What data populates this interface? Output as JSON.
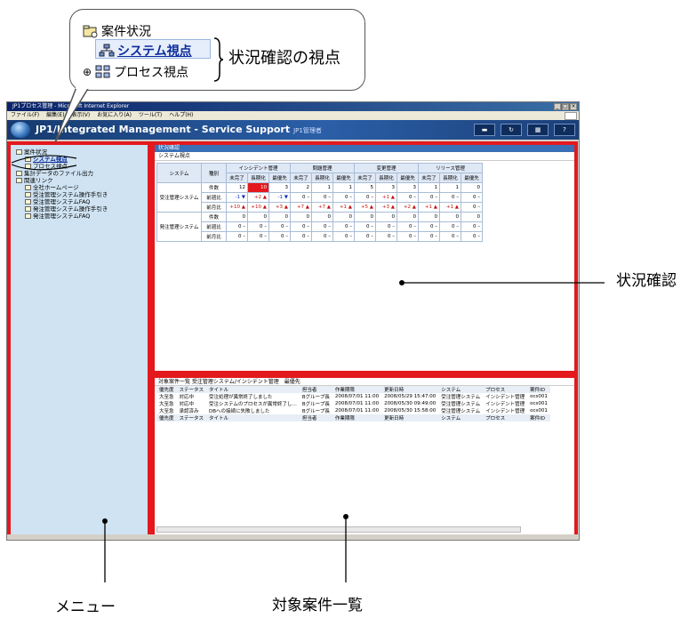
{
  "callout": {
    "line1": "案件状況",
    "line2": "システム視点",
    "line3": "プロセス視点",
    "label": "状況確認の視点"
  },
  "window": {
    "title": "JP1プロセス管理 - Microsoft Internet Explorer",
    "menu": [
      "ファイル(F)",
      "編集(E)",
      "表示(V)",
      "お気に入り(A)",
      "ツール(T)",
      "ヘルプ(H)"
    ],
    "app_title": "JP1/Integrated Management - Service Support",
    "app_user": "JP1管理者"
  },
  "menu_tree": [
    "案件状況",
    "システム視点",
    "プロセス視点",
    "集計データのファイル出力",
    "関連リンク",
    "全社ホームページ",
    "受注管理システム操作手引き",
    "受注管理システムFAQ",
    "発注管理システム操作手引き",
    "発注管理システムFAQ"
  ],
  "status": {
    "header": "状況確認",
    "sub": "システム視点",
    "col_system": "システム",
    "col_kind": "種別",
    "groups": [
      "インシデント管理",
      "問題管理",
      "変更管理",
      "リリース管理"
    ],
    "subcols": [
      "未完了",
      "長期化",
      "最優先"
    ],
    "rows": [
      {
        "system": "受注管理システム",
        "kind": "件数",
        "cells": [
          "12",
          "10",
          "3",
          "2",
          "1",
          "1",
          "5",
          "3",
          "3",
          "1",
          "1",
          "0"
        ]
      },
      {
        "system": "",
        "kind": "前週比",
        "cells": [
          "-1 ▼",
          "+2 ▲",
          "-1 ▼",
          "0 –",
          "0 –",
          "0 –",
          "0 –",
          "+1 ▲",
          "0 –",
          "0 –",
          "0 –",
          "0 –"
        ]
      },
      {
        "system": "",
        "kind": "前月比",
        "cells": [
          "+10 ▲",
          "+10 ▲",
          "+3 ▲",
          "+7 ▲",
          "+7 ▲",
          "+1 ▲",
          "+5 ▲",
          "+3 ▲",
          "+2 ▲",
          "+1 ▲",
          "+1 ▲",
          "0 –"
        ]
      },
      {
        "system": "発注管理システム",
        "kind": "件数",
        "cells": [
          "0",
          "0",
          "0",
          "0",
          "0",
          "0",
          "0",
          "0",
          "0",
          "0",
          "0",
          "0"
        ]
      },
      {
        "system": "",
        "kind": "前週比",
        "cells": [
          "0 –",
          "0 –",
          "0 –",
          "0 –",
          "0 –",
          "0 –",
          "0 –",
          "0 –",
          "0 –",
          "0 –",
          "0 –",
          "0 –"
        ]
      },
      {
        "system": "",
        "kind": "前月比",
        "cells": [
          "0 –",
          "0 –",
          "0 –",
          "0 –",
          "0 –",
          "0 –",
          "0 –",
          "0 –",
          "0 –",
          "0 –",
          "0 –",
          "0 –"
        ]
      }
    ]
  },
  "list": {
    "header": "対象案件一覧 受注管理システム/インシデント管理　最優先",
    "columns": [
      "優先度",
      "ステータス",
      "タイトル",
      "担当者",
      "作業期限",
      "更新日時",
      "システム",
      "プロセス",
      "案件ID"
    ],
    "rows": [
      [
        "大至急",
        "対応中",
        "受注処理が異常終了しました",
        "Bグループ長",
        "2008/07/01 11:00",
        "2008/05/29 15:47:00",
        "受注管理システム",
        "インシデント管理",
        "ocs001"
      ],
      [
        "大至急",
        "対応中",
        "受注システムのプロセスが異常終了し…",
        "Bグループ長",
        "2008/07/01 11:00",
        "2008/05/30 09:49:00",
        "受注管理システム",
        "インシデント管理",
        "ocs001"
      ],
      [
        "大至急",
        "承認済み",
        "DBへの接続に失敗しました",
        "Bグループ長",
        "2008/07/01 11:00",
        "2008/05/30 15:58:00",
        "受注管理システム",
        "インシデント管理",
        "ocs001"
      ]
    ]
  },
  "labels": {
    "status": "状況確認",
    "menu": "メニュー",
    "list": "対象案件一覧"
  },
  "colors": {
    "highlight": "#e3191e",
    "banner": "#2b5fa8",
    "menu_bg": "#cfe3f2"
  }
}
